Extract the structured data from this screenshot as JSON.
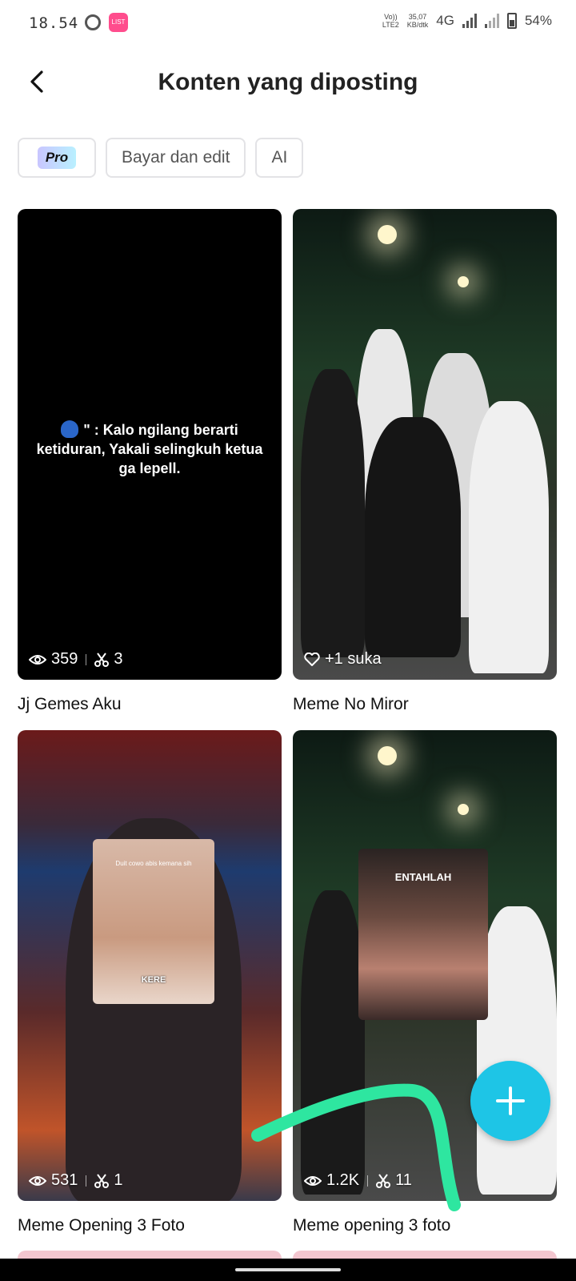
{
  "status_bar": {
    "time": "18.54",
    "app_badge": "LIST",
    "volte_top": "Vo))",
    "volte_bottom": "LTE2",
    "speed_top": "35,07",
    "speed_bottom": "KB/dtk",
    "network": "4G",
    "battery": "54%"
  },
  "header": {
    "title": "Konten yang diposting"
  },
  "chips": {
    "pro": "Pro",
    "pay_edit": "Bayar dan edit",
    "ai": "AI"
  },
  "cards": [
    {
      "title": "Jj Gemes Aku",
      "overlay_text": "\" : Kalo ngilang berarti ketiduran, Yakali selingkuh ketua ga lepell.",
      "views": "359",
      "uses": "3"
    },
    {
      "title": "Meme No Miror",
      "likes": "+1 suka"
    },
    {
      "title": "Meme Opening 3 Foto",
      "pip_top_caption": "Duit cowo abis kemana sih",
      "pip_bottom_caption": "KERE",
      "views": "531",
      "uses": "1"
    },
    {
      "title": "Meme opening 3 foto",
      "pip_top_caption": "ENTAHLAH",
      "views": "1.2K",
      "uses": "11"
    }
  ],
  "colors": {
    "fab": "#1ec5e6",
    "scribble": "#2ee6a0"
  }
}
